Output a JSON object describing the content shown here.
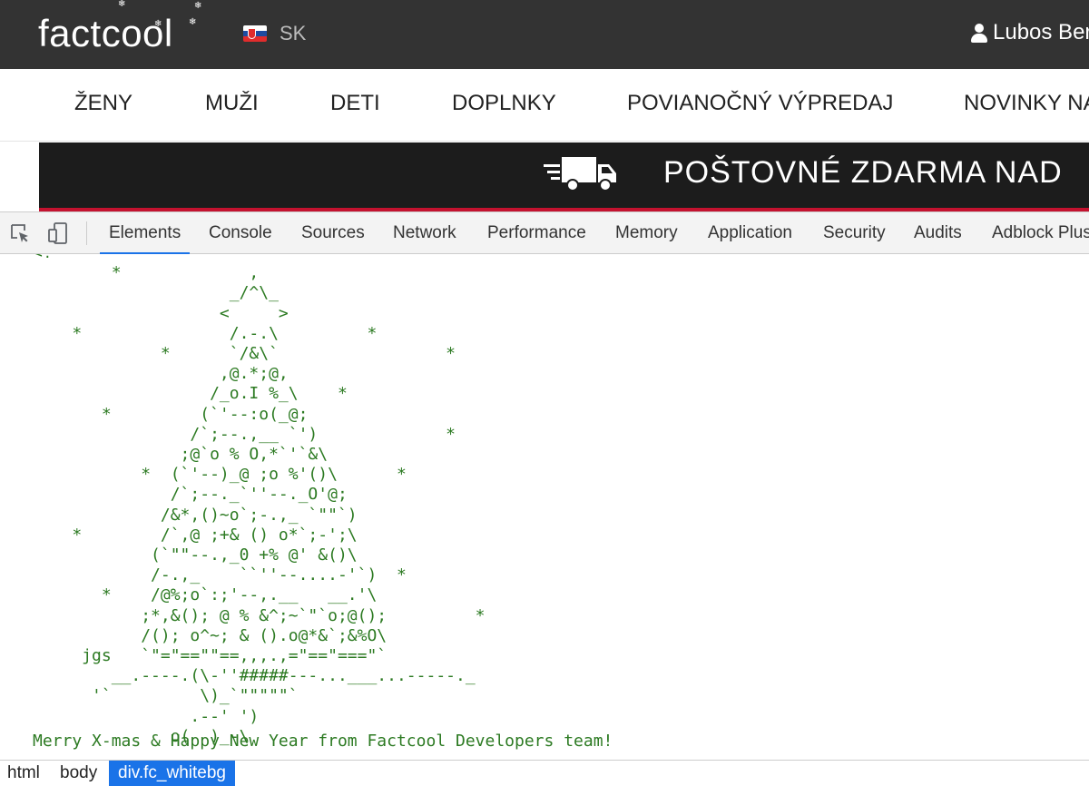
{
  "header": {
    "logo_text": "factcool",
    "lang_code": "SK",
    "user_name": "Lubos Ber"
  },
  "categories": [
    "ŽENY",
    "MUŽI",
    "DETI",
    "DOPLNKY",
    "POVIANOČNÝ VÝPREDAJ",
    "NOVINKY NA"
  ],
  "banner": {
    "text": "POŠTOVNÉ ZDARMA NAD"
  },
  "devtools": {
    "tabs": [
      "Elements",
      "Console",
      "Sources",
      "Network",
      "Performance",
      "Memory",
      "Application",
      "Security",
      "Audits",
      "Adblock Plus"
    ],
    "active_tab": "Elements"
  },
  "elements": {
    "ascii_art": "<!--\n        *             ,\n                    _/^\\_\n                   <     >\n    *               /.-.\\         *\n             *      `/&\\`                 *\n                   ,@.*;@,\n                  /_o.I %_\\    *\n       *         (`'--:o(_@;\n                /`;--.,__ `')             *\n               ;@`o % O,*`'`&\\\n           *  (`'--)_@ ;o %'()\\      *\n              /`;--._`''--._O'@;\n             /&*,()~o`;-.,_ `\"\"`)\n    *        /`,@ ;+& () o*`;-';\\\n            (`\"\"--.,_0 +% @' &()\\\n            /-.,_    ``''--....-'`)  *\n       *    /@%;o`:;'--,.__   __.'\\\n           ;*,&(); @ % &^;~`\"`o;@();         *\n           /(); o^~; & ().o@*&`;&%O\\\n     jgs   `\"=\"==\"\"==,,,.,=\"==\"===\"`\n        __.----.(\\-''#####---...___...-----._\n      '`         \\)_`\"\"\"\"\"`\n                .--' ')\n              o(  )_-\\",
    "footer_message": "Merry X-mas & Happy New Year from Factcool Developers team!"
  },
  "breadcrumbs": [
    "html",
    "body",
    "div.fc_whitebg"
  ],
  "colors": {
    "header_bg": "#333333",
    "banner_bg": "#1c1c1c",
    "banner_accent": "#c4122f",
    "ascii_green": "#2c7a22",
    "devtools_accent": "#1a73e8"
  },
  "icons": {
    "flag": "slovakia-flag-icon",
    "user": "user-icon",
    "truck": "delivery-truck-icon",
    "inspect": "inspect-element-icon",
    "device": "device-toolbar-icon"
  }
}
